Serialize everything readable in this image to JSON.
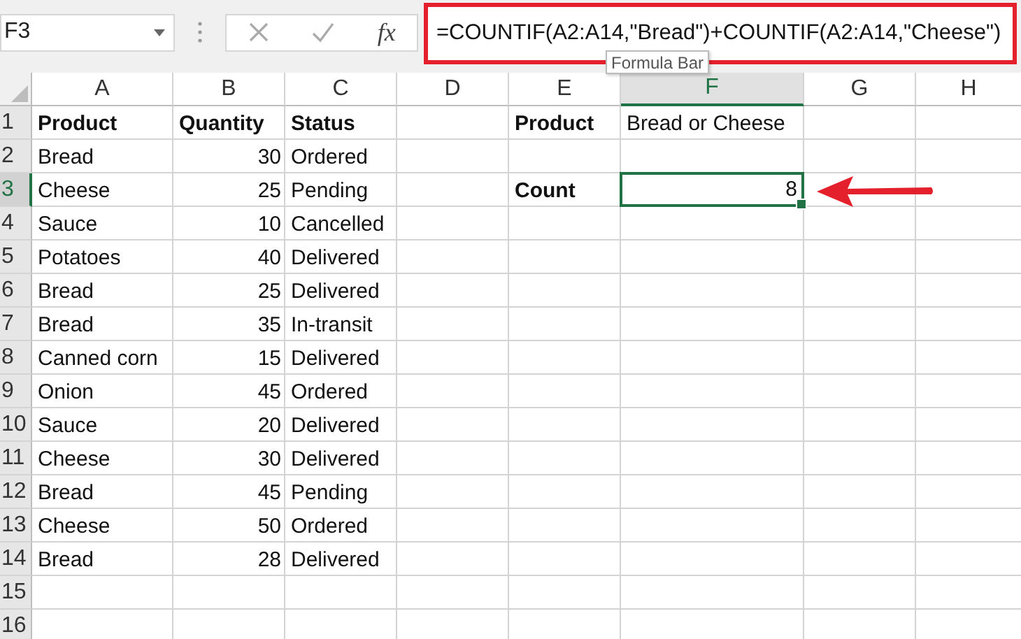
{
  "formula_bar": {
    "name_box": "F3",
    "fx": "fx",
    "formula": "=COUNTIF(A2:A14,\"Bread\")+COUNTIF(A2:A14,\"Cheese\")",
    "tooltip": "Formula Bar"
  },
  "columns": [
    {
      "label": "A",
      "selected": false
    },
    {
      "label": "B",
      "selected": false
    },
    {
      "label": "C",
      "selected": false
    },
    {
      "label": "D",
      "selected": false
    },
    {
      "label": "E",
      "selected": false
    },
    {
      "label": "F",
      "selected": true
    },
    {
      "label": "G",
      "selected": false
    },
    {
      "label": "H",
      "selected": false
    }
  ],
  "rows": [
    {
      "header": "1",
      "selected": false,
      "cells": [
        {
          "kind": "text",
          "text": "Product",
          "bold": true
        },
        {
          "kind": "text",
          "text": "Quantity",
          "bold": true
        },
        {
          "kind": "text",
          "text": "Status",
          "bold": true
        },
        {
          "kind": "empty"
        },
        {
          "kind": "text",
          "text": "Product",
          "bold": true
        },
        {
          "kind": "text",
          "text": "Bread or Cheese",
          "bold": false
        },
        {
          "kind": "empty"
        },
        {
          "kind": "empty"
        }
      ]
    },
    {
      "header": "2",
      "selected": false,
      "cells": [
        {
          "kind": "text",
          "text": "Bread",
          "bold": false
        },
        {
          "kind": "number",
          "text": "30",
          "bold": false
        },
        {
          "kind": "text",
          "text": "Ordered",
          "bold": false
        },
        {
          "kind": "empty"
        },
        {
          "kind": "empty"
        },
        {
          "kind": "empty"
        },
        {
          "kind": "empty"
        },
        {
          "kind": "empty"
        }
      ]
    },
    {
      "header": "3",
      "selected": true,
      "cells": [
        {
          "kind": "text",
          "text": "Cheese",
          "bold": false
        },
        {
          "kind": "number",
          "text": "25",
          "bold": false
        },
        {
          "kind": "text",
          "text": "Pending",
          "bold": false
        },
        {
          "kind": "empty"
        },
        {
          "kind": "text",
          "text": "Count",
          "bold": true
        },
        {
          "kind": "number",
          "text": "8",
          "bold": false
        },
        {
          "kind": "empty"
        },
        {
          "kind": "empty"
        }
      ]
    },
    {
      "header": "4",
      "selected": false,
      "cells": [
        {
          "kind": "text",
          "text": "Sauce",
          "bold": false
        },
        {
          "kind": "number",
          "text": "10",
          "bold": false
        },
        {
          "kind": "text",
          "text": "Cancelled",
          "bold": false
        },
        {
          "kind": "empty"
        },
        {
          "kind": "empty"
        },
        {
          "kind": "empty"
        },
        {
          "kind": "empty"
        },
        {
          "kind": "empty"
        }
      ]
    },
    {
      "header": "5",
      "selected": false,
      "cells": [
        {
          "kind": "text",
          "text": "Potatoes",
          "bold": false
        },
        {
          "kind": "number",
          "text": "40",
          "bold": false
        },
        {
          "kind": "text",
          "text": "Delivered",
          "bold": false
        },
        {
          "kind": "empty"
        },
        {
          "kind": "empty"
        },
        {
          "kind": "empty"
        },
        {
          "kind": "empty"
        },
        {
          "kind": "empty"
        }
      ]
    },
    {
      "header": "6",
      "selected": false,
      "cells": [
        {
          "kind": "text",
          "text": "Bread",
          "bold": false
        },
        {
          "kind": "number",
          "text": "25",
          "bold": false
        },
        {
          "kind": "text",
          "text": "Delivered",
          "bold": false
        },
        {
          "kind": "empty"
        },
        {
          "kind": "empty"
        },
        {
          "kind": "empty"
        },
        {
          "kind": "empty"
        },
        {
          "kind": "empty"
        }
      ]
    },
    {
      "header": "7",
      "selected": false,
      "cells": [
        {
          "kind": "text",
          "text": "Bread",
          "bold": false
        },
        {
          "kind": "number",
          "text": "35",
          "bold": false
        },
        {
          "kind": "text",
          "text": "In-transit",
          "bold": false
        },
        {
          "kind": "empty"
        },
        {
          "kind": "empty"
        },
        {
          "kind": "empty"
        },
        {
          "kind": "empty"
        },
        {
          "kind": "empty"
        }
      ]
    },
    {
      "header": "8",
      "selected": false,
      "cells": [
        {
          "kind": "text",
          "text": "Canned corn",
          "bold": false
        },
        {
          "kind": "number",
          "text": "15",
          "bold": false
        },
        {
          "kind": "text",
          "text": "Delivered",
          "bold": false
        },
        {
          "kind": "empty"
        },
        {
          "kind": "empty"
        },
        {
          "kind": "empty"
        },
        {
          "kind": "empty"
        },
        {
          "kind": "empty"
        }
      ]
    },
    {
      "header": "9",
      "selected": false,
      "cells": [
        {
          "kind": "text",
          "text": "Onion",
          "bold": false
        },
        {
          "kind": "number",
          "text": "45",
          "bold": false
        },
        {
          "kind": "text",
          "text": "Ordered",
          "bold": false
        },
        {
          "kind": "empty"
        },
        {
          "kind": "empty"
        },
        {
          "kind": "empty"
        },
        {
          "kind": "empty"
        },
        {
          "kind": "empty"
        }
      ]
    },
    {
      "header": "10",
      "selected": false,
      "cells": [
        {
          "kind": "text",
          "text": "Sauce",
          "bold": false
        },
        {
          "kind": "number",
          "text": "20",
          "bold": false
        },
        {
          "kind": "text",
          "text": "Delivered",
          "bold": false
        },
        {
          "kind": "empty"
        },
        {
          "kind": "empty"
        },
        {
          "kind": "empty"
        },
        {
          "kind": "empty"
        },
        {
          "kind": "empty"
        }
      ]
    },
    {
      "header": "11",
      "selected": false,
      "cells": [
        {
          "kind": "text",
          "text": "Cheese",
          "bold": false
        },
        {
          "kind": "number",
          "text": "30",
          "bold": false
        },
        {
          "kind": "text",
          "text": "Delivered",
          "bold": false
        },
        {
          "kind": "empty"
        },
        {
          "kind": "empty"
        },
        {
          "kind": "empty"
        },
        {
          "kind": "empty"
        },
        {
          "kind": "empty"
        }
      ]
    },
    {
      "header": "12",
      "selected": false,
      "cells": [
        {
          "kind": "text",
          "text": "Bread",
          "bold": false
        },
        {
          "kind": "number",
          "text": "45",
          "bold": false
        },
        {
          "kind": "text",
          "text": "Pending",
          "bold": false
        },
        {
          "kind": "empty"
        },
        {
          "kind": "empty"
        },
        {
          "kind": "empty"
        },
        {
          "kind": "empty"
        },
        {
          "kind": "empty"
        }
      ]
    },
    {
      "header": "13",
      "selected": false,
      "cells": [
        {
          "kind": "text",
          "text": "Cheese",
          "bold": false
        },
        {
          "kind": "number",
          "text": "50",
          "bold": false
        },
        {
          "kind": "text",
          "text": "Ordered",
          "bold": false
        },
        {
          "kind": "empty"
        },
        {
          "kind": "empty"
        },
        {
          "kind": "empty"
        },
        {
          "kind": "empty"
        },
        {
          "kind": "empty"
        }
      ]
    },
    {
      "header": "14",
      "selected": false,
      "cells": [
        {
          "kind": "text",
          "text": "Bread",
          "bold": false
        },
        {
          "kind": "number",
          "text": "28",
          "bold": false
        },
        {
          "kind": "text",
          "text": "Delivered",
          "bold": false
        },
        {
          "kind": "empty"
        },
        {
          "kind": "empty"
        },
        {
          "kind": "empty"
        },
        {
          "kind": "empty"
        },
        {
          "kind": "empty"
        }
      ]
    },
    {
      "header": "15",
      "selected": false,
      "cells": [
        {
          "kind": "empty"
        },
        {
          "kind": "empty"
        },
        {
          "kind": "empty"
        },
        {
          "kind": "empty"
        },
        {
          "kind": "empty"
        },
        {
          "kind": "empty"
        },
        {
          "kind": "empty"
        },
        {
          "kind": "empty"
        }
      ]
    },
    {
      "header": "16",
      "selected": false,
      "cells": [
        {
          "kind": "empty"
        },
        {
          "kind": "empty"
        },
        {
          "kind": "empty"
        },
        {
          "kind": "empty"
        },
        {
          "kind": "empty"
        },
        {
          "kind": "empty"
        },
        {
          "kind": "empty"
        },
        {
          "kind": "empty"
        }
      ]
    }
  ]
}
